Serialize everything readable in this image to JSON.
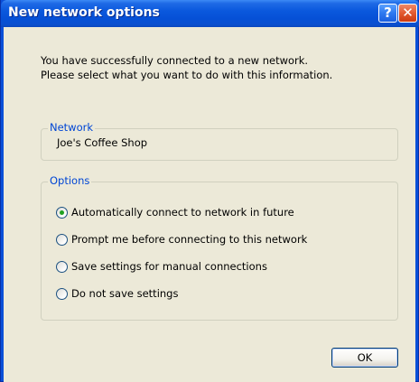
{
  "window": {
    "title": "New network options",
    "help_glyph": "?",
    "close_glyph": "✕"
  },
  "intro": {
    "line1": "You have successfully connected to a new network.",
    "line2": "Please select what you want to do with this information."
  },
  "network": {
    "label": "Network",
    "value": "Joe's Coffee Shop"
  },
  "options": {
    "label": "Options",
    "selected_index": 0,
    "items": [
      {
        "label": "Automatically connect to network in future",
        "checked": true
      },
      {
        "label": "Prompt me before connecting to this network",
        "checked": false
      },
      {
        "label": "Save settings for manual connections",
        "checked": false
      },
      {
        "label": "Do not save settings",
        "checked": false
      }
    ]
  },
  "buttons": {
    "ok_label": "OK"
  },
  "colors": {
    "titlebar": "#0a58dd",
    "dialog_face": "#ece9d8",
    "group_label": "#0046d5",
    "radio_dot": "#21a121"
  }
}
